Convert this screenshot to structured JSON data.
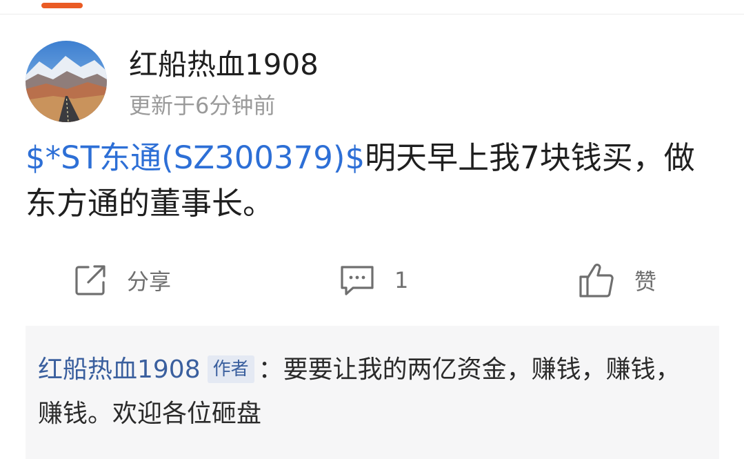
{
  "header": {
    "accent_color": "#ea5b24"
  },
  "post": {
    "author_name": "红船热血1908",
    "update_time": "更新于6分钟前",
    "stock_link": "$*ST东通(SZ300379)$",
    "body_text": "明天早上我7块钱买，做东方通的董事长。"
  },
  "actions": {
    "share_label": "分享",
    "comment_count": "1",
    "like_label": "赞"
  },
  "comment": {
    "author": "红船热血1908",
    "badge": "作者",
    "separator": "：",
    "text": "要要让我的两亿资金，赚钱，赚钱，赚钱。欢迎各位砸盘"
  }
}
